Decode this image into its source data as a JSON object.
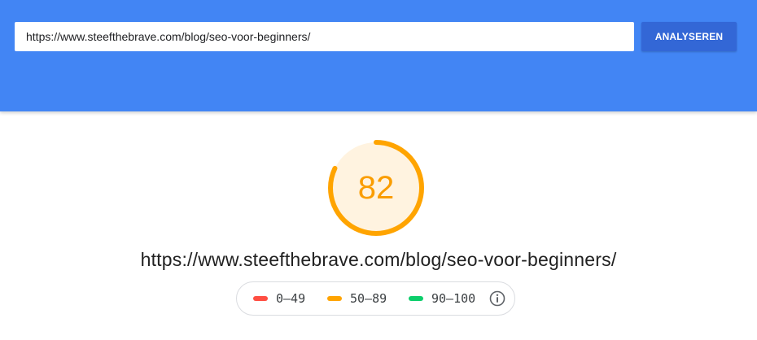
{
  "search": {
    "url_value": "https://www.steefthebrave.com/blog/seo-voor-beginners/",
    "button_label": "ANALYSEREN"
  },
  "result": {
    "score": "82",
    "score_value": 82,
    "url": "https://www.steefthebrave.com/blog/seo-voor-beginners/"
  },
  "legend": {
    "items": [
      {
        "label": "0–49",
        "color": "#ff4e42"
      },
      {
        "label": "50–89",
        "color": "#ffa400"
      },
      {
        "label": "90–100",
        "color": "#0cce6b"
      }
    ],
    "info_icon": "info-icon"
  },
  "colors": {
    "header_bg": "#4285f4",
    "button_bg": "#3367d6",
    "score_ring": "#ffa400",
    "score_fill": "#fff3e0",
    "score_text": "#fa9d00"
  }
}
